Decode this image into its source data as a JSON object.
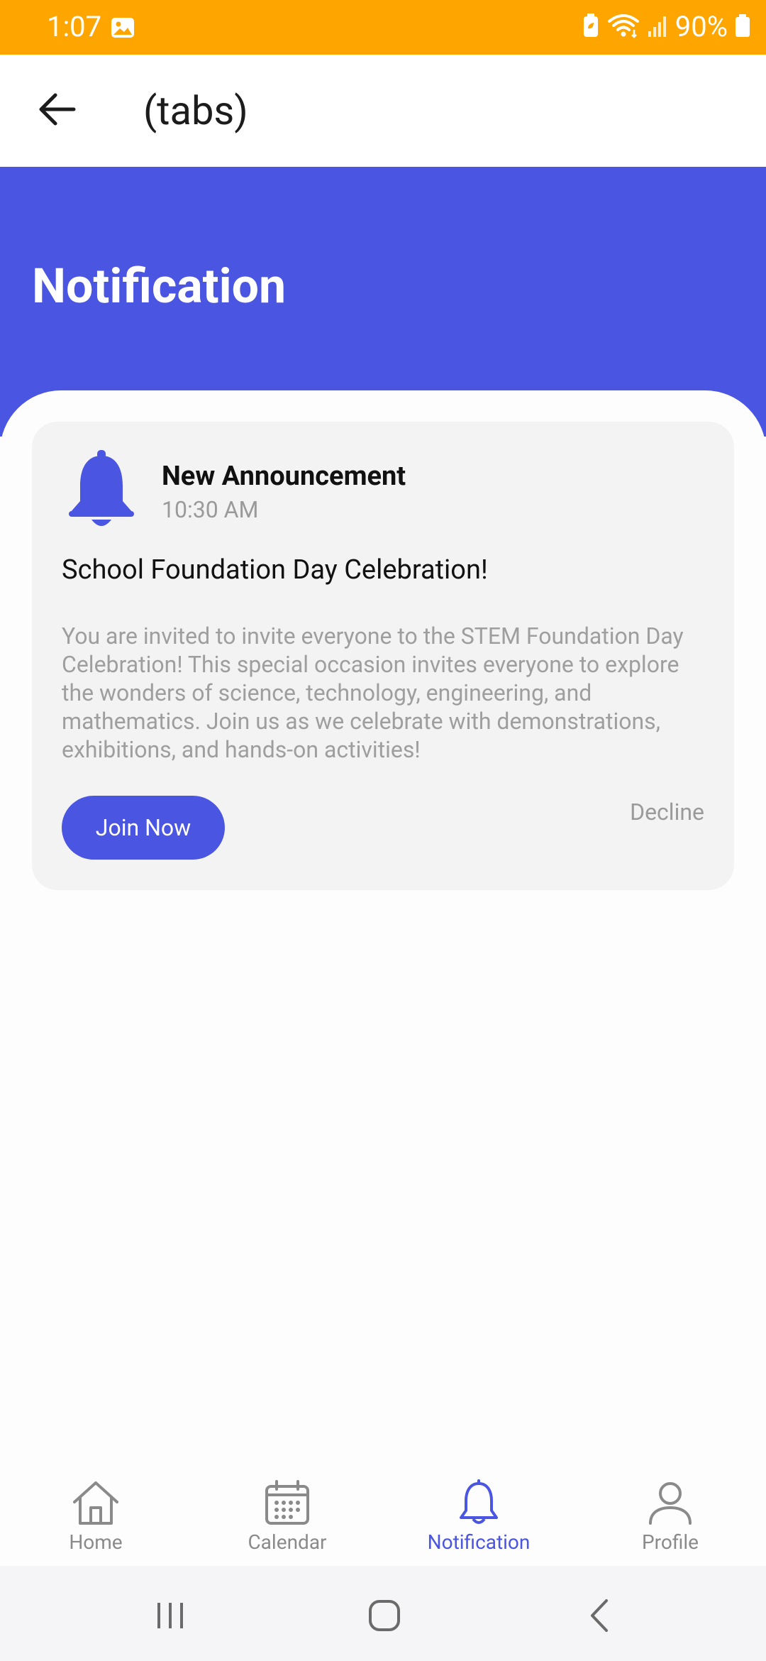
{
  "status_bar": {
    "time": "1:07",
    "battery_percent": "90%",
    "icons": [
      "gallery-icon",
      "battery-saver-icon",
      "wifi-icon",
      "signal-icon",
      "battery-icon"
    ]
  },
  "app_bar": {
    "title": "(tabs)",
    "back_icon": "arrow-left-icon"
  },
  "hero": {
    "title": "Notification"
  },
  "notification_card": {
    "icon": "bell-icon",
    "title": "New Announcement",
    "time": "10:30 AM",
    "headline": "School Foundation Day Celebration!",
    "body": "You are invited to invite everyone to the STEM Foundation Day Celebration! This special occasion invites everyone to explore the wonders of science, technology, engineering, and mathematics. Join us as we celebrate with demonstrations, exhibitions, and hands-on activities!",
    "join_label": "Join Now",
    "decline_label": "Decline"
  },
  "tab_bar": {
    "tabs": [
      {
        "label": "Home",
        "icon": "home-icon",
        "active": false
      },
      {
        "label": "Calendar",
        "icon": "calendar-icon",
        "active": false
      },
      {
        "label": "Notification",
        "icon": "bell-icon",
        "active": true
      },
      {
        "label": "Profile",
        "icon": "profile-icon",
        "active": false
      }
    ]
  },
  "system_nav": {
    "buttons": [
      "recent-apps-icon",
      "home-circle-icon",
      "back-chevron-icon"
    ]
  },
  "colors": {
    "status_bar": "#ffa500",
    "accent": "#4a55e1",
    "inactive": "#8a8a8a",
    "card_bg": "#f3f3f3"
  }
}
